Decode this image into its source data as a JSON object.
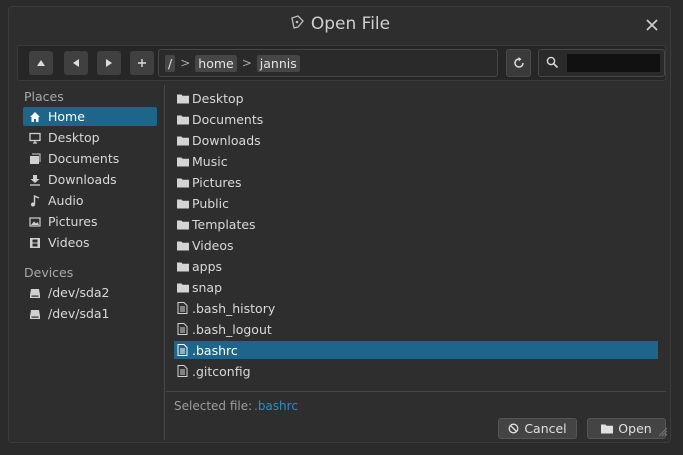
{
  "window": {
    "title": "Open File"
  },
  "toolbar": {
    "up_label": "▲",
    "back_label": "◀",
    "forward_label": "▶",
    "new_folder_label": "+",
    "path": [
      "/",
      "home",
      "jannis"
    ],
    "path_separator": ">",
    "search_value": ""
  },
  "sidebar": {
    "places_title": "Places",
    "places": [
      {
        "label": "Home",
        "icon": "home-icon",
        "selected": true
      },
      {
        "label": "Desktop",
        "icon": "monitor-icon"
      },
      {
        "label": "Documents",
        "icon": "document-icon"
      },
      {
        "label": "Downloads",
        "icon": "download-icon"
      },
      {
        "label": "Audio",
        "icon": "music-note-icon"
      },
      {
        "label": "Pictures",
        "icon": "image-icon"
      },
      {
        "label": "Videos",
        "icon": "film-icon"
      }
    ],
    "devices_title": "Devices",
    "devices": [
      {
        "label": "/dev/sda2",
        "icon": "drive-icon"
      },
      {
        "label": "/dev/sda1",
        "icon": "drive-icon"
      }
    ]
  },
  "files": [
    {
      "name": "Desktop",
      "type": "folder"
    },
    {
      "name": "Documents",
      "type": "folder"
    },
    {
      "name": "Downloads",
      "type": "folder"
    },
    {
      "name": "Music",
      "type": "folder"
    },
    {
      "name": "Pictures",
      "type": "folder"
    },
    {
      "name": "Public",
      "type": "folder"
    },
    {
      "name": "Templates",
      "type": "folder"
    },
    {
      "name": "Videos",
      "type": "folder"
    },
    {
      "name": "apps",
      "type": "folder"
    },
    {
      "name": "snap",
      "type": "folder"
    },
    {
      "name": ".bash_history",
      "type": "file"
    },
    {
      "name": ".bash_logout",
      "type": "file"
    },
    {
      "name": ".bashrc",
      "type": "file",
      "selected": true
    },
    {
      "name": ".gitconfig",
      "type": "file"
    }
  ],
  "footer": {
    "selected_label": "Selected file:",
    "selected_value": ".bashrc",
    "cancel_label": "Cancel",
    "open_label": "Open"
  },
  "colors": {
    "accent": "#1d6689",
    "selected_text": "#2a8fc0",
    "background": "#2e2e2e"
  }
}
